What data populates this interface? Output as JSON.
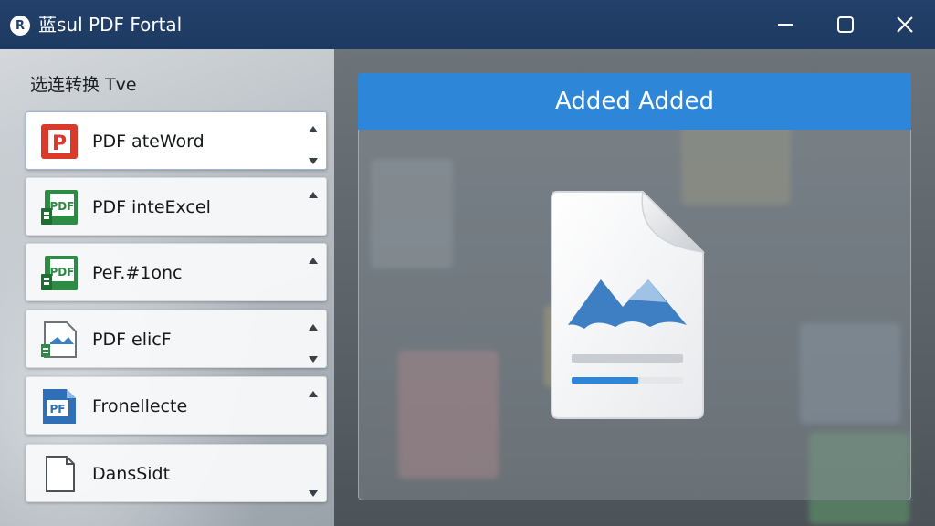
{
  "window": {
    "title": "蓝sul PDF Fortal",
    "logo_letter": "R",
    "controls": [
      "minimize-icon",
      "maximize-icon",
      "close-icon"
    ]
  },
  "sidebar": {
    "heading": "选连转换 Tve",
    "items": [
      {
        "label": "PDF ateWord",
        "icon": "pdf-red-icon",
        "icon_text": "P",
        "color": "#d93a2b",
        "selected": true,
        "arrows": [
          "up",
          "down"
        ]
      },
      {
        "label": "PDF inteExcel",
        "icon": "excel-green-icon",
        "icon_text": "PDF",
        "color": "#2e8b45",
        "selected": false,
        "arrows": [
          "up"
        ]
      },
      {
        "label": "PeF.#1onc",
        "icon": "excel-green-icon",
        "icon_text": "PDF",
        "color": "#2e8b45",
        "selected": false,
        "arrows": [
          "up"
        ]
      },
      {
        "label": "PDF elicF",
        "icon": "image-file-icon",
        "icon_text": "",
        "color": "#3a7fc0",
        "selected": false,
        "arrows": [
          "up",
          "down"
        ]
      },
      {
        "label": "Fronellecte",
        "icon": "blue-file-icon",
        "icon_text": "PF",
        "color": "#2e6fb8",
        "selected": false,
        "arrows": [
          "up"
        ]
      },
      {
        "label": "DansSidt",
        "icon": "blank-file-icon",
        "icon_text": "",
        "color": "#9aa0a6",
        "selected": false,
        "arrows": [
          "down"
        ]
      }
    ]
  },
  "main": {
    "add_button_label": "Added Added",
    "file_icon": "image-document-icon",
    "progress_fraction": 0.6,
    "accent": "#2e86d8"
  }
}
